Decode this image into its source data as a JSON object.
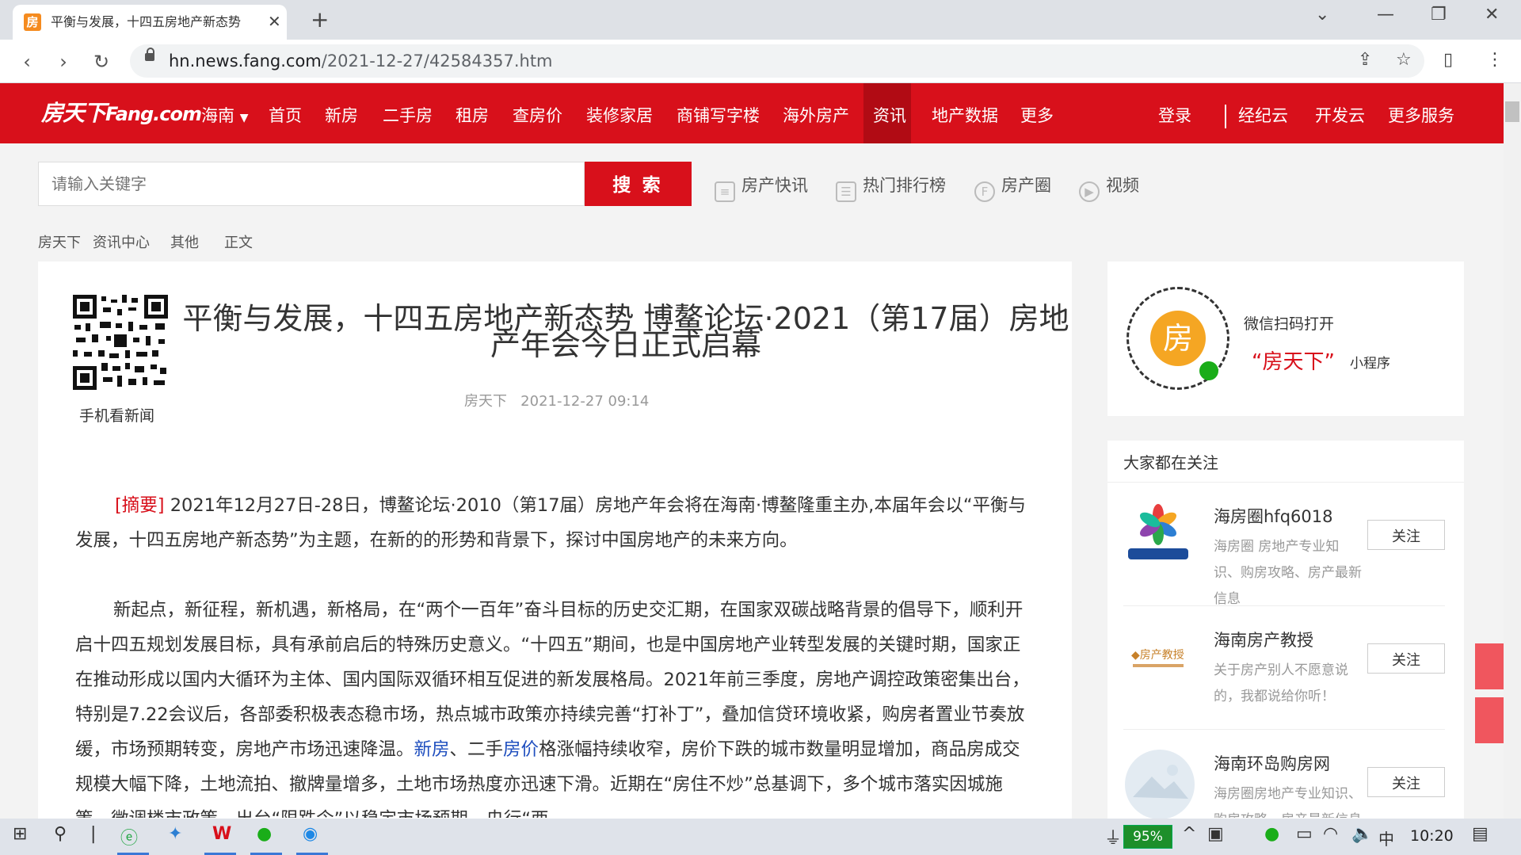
{
  "browser": {
    "tab_title": "平衡与发展，十四五房地产新态势",
    "favicon": "房",
    "url_host": "hn.news.fang.com",
    "url_path": "/2021-12-27/42584357.htm"
  },
  "site": {
    "logo": "房天下",
    "logo_suffix": "Fang.com",
    "city": "海南",
    "nav": [
      "首页",
      "新房",
      "二手房",
      "租房",
      "查房价",
      "装修家居",
      "商铺写字楼",
      "海外房产",
      "资讯",
      "地产数据",
      "更多"
    ],
    "nav_right": [
      "登录",
      "经纪云",
      "开发云",
      "更多服务"
    ],
    "brand_color": "#d8101b"
  },
  "search": {
    "placeholder": "请输入关键字",
    "button": "搜 索",
    "quick_links": [
      "房产快讯",
      "热门排行榜",
      "房产圈",
      "视频"
    ]
  },
  "breadcrumb": [
    "房天下",
    "资讯中心",
    "其他",
    "正文"
  ],
  "article": {
    "qr_label": "手机看新闻",
    "title": "平衡与发展，十四五房地产新态势 博鳌论坛·2021（第17届）房地产年会今日正式启幕",
    "source": "房天下",
    "datetime": "2021-12-27 09:14",
    "abstract_tag": "[摘要]",
    "abstract": "2021年12月27日-28日，博鳌论坛·2010（第17届）房地产年会将在海南·博鳌隆重主办,本届年会以“平衡与发展，十四五房地产新态势”为主题，在新的的形势和背景下，探讨中国房地产的未来方向。",
    "para1_a": "新起点，新征程，新机遇，新格局，在“两个一百年”奋斗目标的历史交汇期，在国家双碳战略背景的倡导下，顺利开启十四五规划发展目标，具有承前启后的特殊历史意义。“十四五”期间，也是中国房地产业转型发展的关键时期，国家正在推动形成以国内大循环为主体、国内国际双循环相互促进的新发展格局。2021年前三季度，房地产调控政策密集出台，特别是7.22会议后，各部委积极表态稳市场，热点城市政策亦持续完善“打补丁”，叠加信贷环境收紧，购房者置业节奏放缓，市场预期转变，房地产市场迅速降温。",
    "para1_link1": "新房",
    "para1_b": "、二手",
    "para1_link2": "房价",
    "para1_c": "格涨幅持续收窄，房价下跌的城市数量明显增加，商品房成交规模大幅下降，土地流拍、撤牌量增多，土地市场热度亦迅速下滑。近期在“房住不炒”总基调下，多个城市落实因城施策，微调楼市政策，出台“限跌令”以稳定市场预期，央行“西"
  },
  "sidebar": {
    "wechat_text": "微信扫码打开",
    "mini_name": "“房天下”",
    "mini_suffix": "小程序",
    "follow_title": "大家都在关注",
    "follow_button": "关注",
    "follows": [
      {
        "name": "海房圈hfq6018",
        "desc": "海房圈 房地产专业知识、购房攻略、房产最新信息"
      },
      {
        "name": "海南房产教授",
        "desc": "关于房产别人不愿意说的，我都说给你听！"
      },
      {
        "name": "海南环岛购房网",
        "desc": "海房圈房地产专业知识、购房攻略、房产最新信息"
      }
    ]
  },
  "taskbar": {
    "battery": "95%",
    "ime": "中",
    "time": "10:20"
  }
}
